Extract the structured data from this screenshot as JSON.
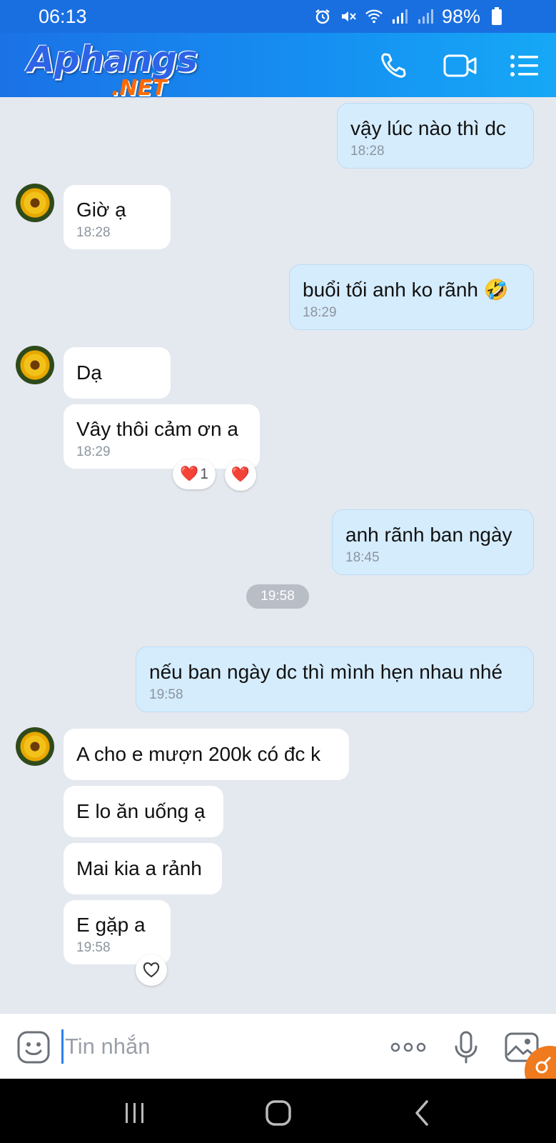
{
  "status_bar": {
    "time": "06:13",
    "battery": "98%",
    "icons": [
      "alarm-icon",
      "mute-icon",
      "wifi-icon",
      "signal-icon",
      "signal-icon",
      "battery-icon"
    ]
  },
  "header": {
    "logo_main": "Aphangs",
    "logo_net": ".NET",
    "icons": [
      "phone-icon",
      "video-call-icon",
      "menu-list-icon"
    ]
  },
  "messages": [
    {
      "side": "out",
      "text": "vậy lúc nào thì dc",
      "time": "18:28"
    },
    {
      "side": "in",
      "text": "Giờ ạ",
      "time": "18:28"
    },
    {
      "side": "out",
      "text": "buổi tối anh ko rãnh 🤣",
      "time": "18:29"
    },
    {
      "side": "in",
      "text": "Dạ",
      "time": ""
    },
    {
      "side": "in",
      "text": "Vây thôi cảm ơn a",
      "time": "18:29"
    },
    {
      "side": "out",
      "text": "anh rãnh ban ngày",
      "time": "18:45"
    },
    {
      "side": "out",
      "text": "nếu ban ngày dc thì mình hẹn nhau nhé",
      "time": "19:58"
    },
    {
      "side": "in",
      "text": "A cho e mượn 200k có đc k",
      "time": ""
    },
    {
      "side": "in",
      "text": "E lo ăn uống ạ",
      "time": ""
    },
    {
      "side": "in",
      "text": "Mai kia a rảnh",
      "time": ""
    },
    {
      "side": "in",
      "text": "E gặp a",
      "time": "19:58"
    }
  ],
  "reactions": {
    "heart_count": "1",
    "heart_emoji": "❤️"
  },
  "divider_time": "19:58",
  "input": {
    "placeholder": "Tin nhắn"
  },
  "colors": {
    "header_start": "#1b72e6",
    "header_end": "#16a8f6",
    "bubble_out": "#d5ecfd",
    "bubble_in": "#ffffff",
    "chat_bg": "#e4e8ef",
    "cursor": "#2a7ff0",
    "fab": "#f07a1e"
  }
}
